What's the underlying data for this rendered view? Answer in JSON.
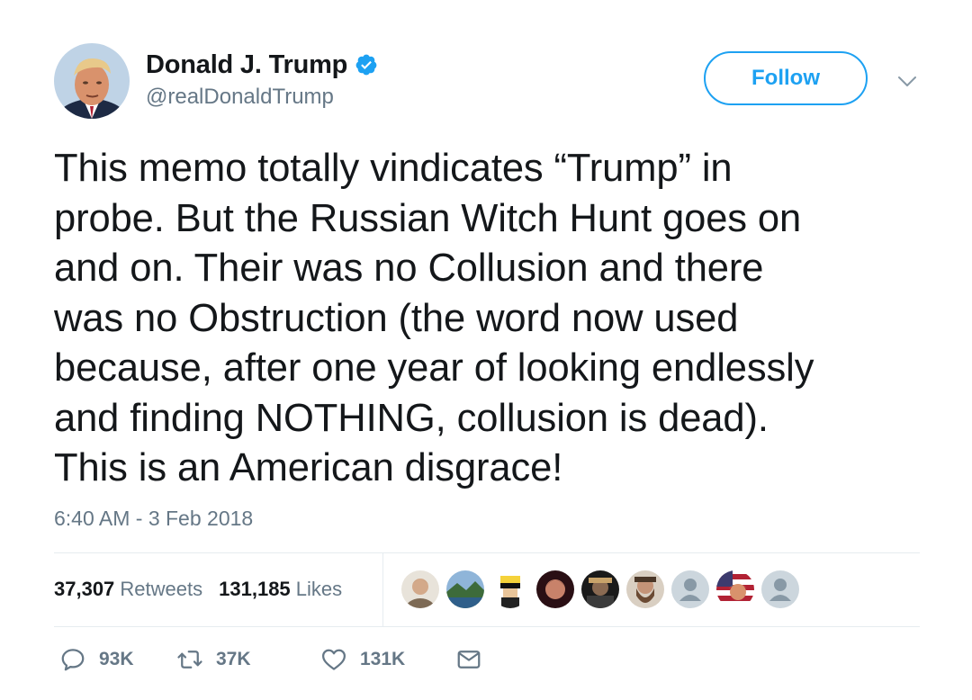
{
  "author": {
    "name": "Donald J. Trump",
    "handle": "@realDonaldTrump",
    "verified": true
  },
  "follow_label": "Follow",
  "tweet_text": "This memo totally vindicates “Trump” in\nprobe. But the Russian Witch Hunt goes on\nand on. Their was no Collusion and there\nwas no Obstruction (the word now used\nbecause, after one year of looking endlessly\nand finding NOTHING, collusion is dead).\nThis is an American disgrace!",
  "timestamp": "6:40 AM - 3 Feb 2018",
  "stats": {
    "retweets_count": "37,307",
    "retweets_label": "Retweets",
    "likes_count": "131,185",
    "likes_label": "Likes"
  },
  "likers": [
    "liker-1",
    "liker-2",
    "liker-3",
    "liker-4",
    "liker-5",
    "liker-6",
    "liker-7",
    "liker-8",
    "liker-9"
  ],
  "actions": {
    "replies": "93K",
    "retweets": "37K",
    "likes": "131K"
  },
  "colors": {
    "accent": "#1da1f2",
    "text": "#14171a",
    "secondary": "#657786",
    "divider": "#e6ecf0"
  }
}
